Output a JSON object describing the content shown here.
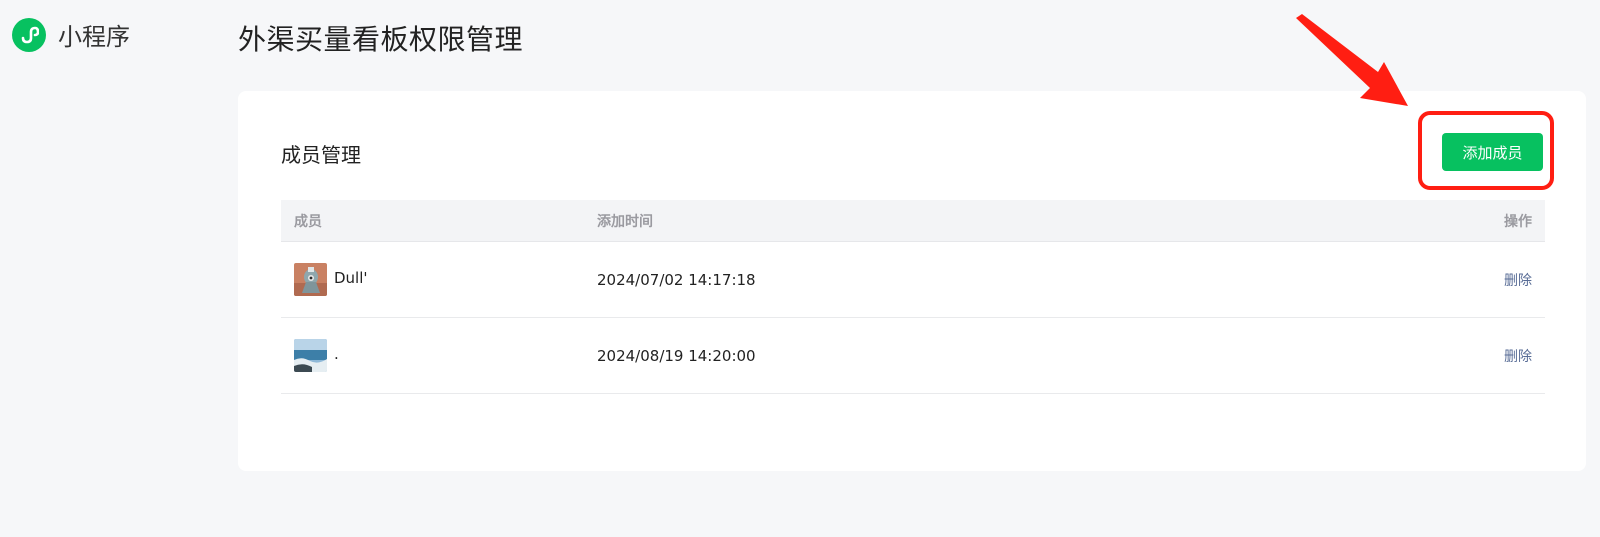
{
  "app": {
    "name": "小程序"
  },
  "page": {
    "title": "外渠买量看板权限管理"
  },
  "panel": {
    "section_title": "成员管理",
    "add_button_label": "添加成员"
  },
  "table": {
    "headers": {
      "member": "成员",
      "added_time": "添加时间",
      "action": "操作"
    },
    "rows": [
      {
        "name": "Dull'",
        "added_time": "2024/07/02 14:17:18",
        "action": "删除"
      },
      {
        "name": ".",
        "added_time": "2024/08/19 14:20:00",
        "action": "删除"
      }
    ]
  },
  "colors": {
    "accent_green": "#07c160",
    "link_blue": "#576b95",
    "annotation_red": "#ff1e12"
  },
  "icons": {
    "logo": "mini-program-icon",
    "annotation": "red-arrow-pointer"
  }
}
